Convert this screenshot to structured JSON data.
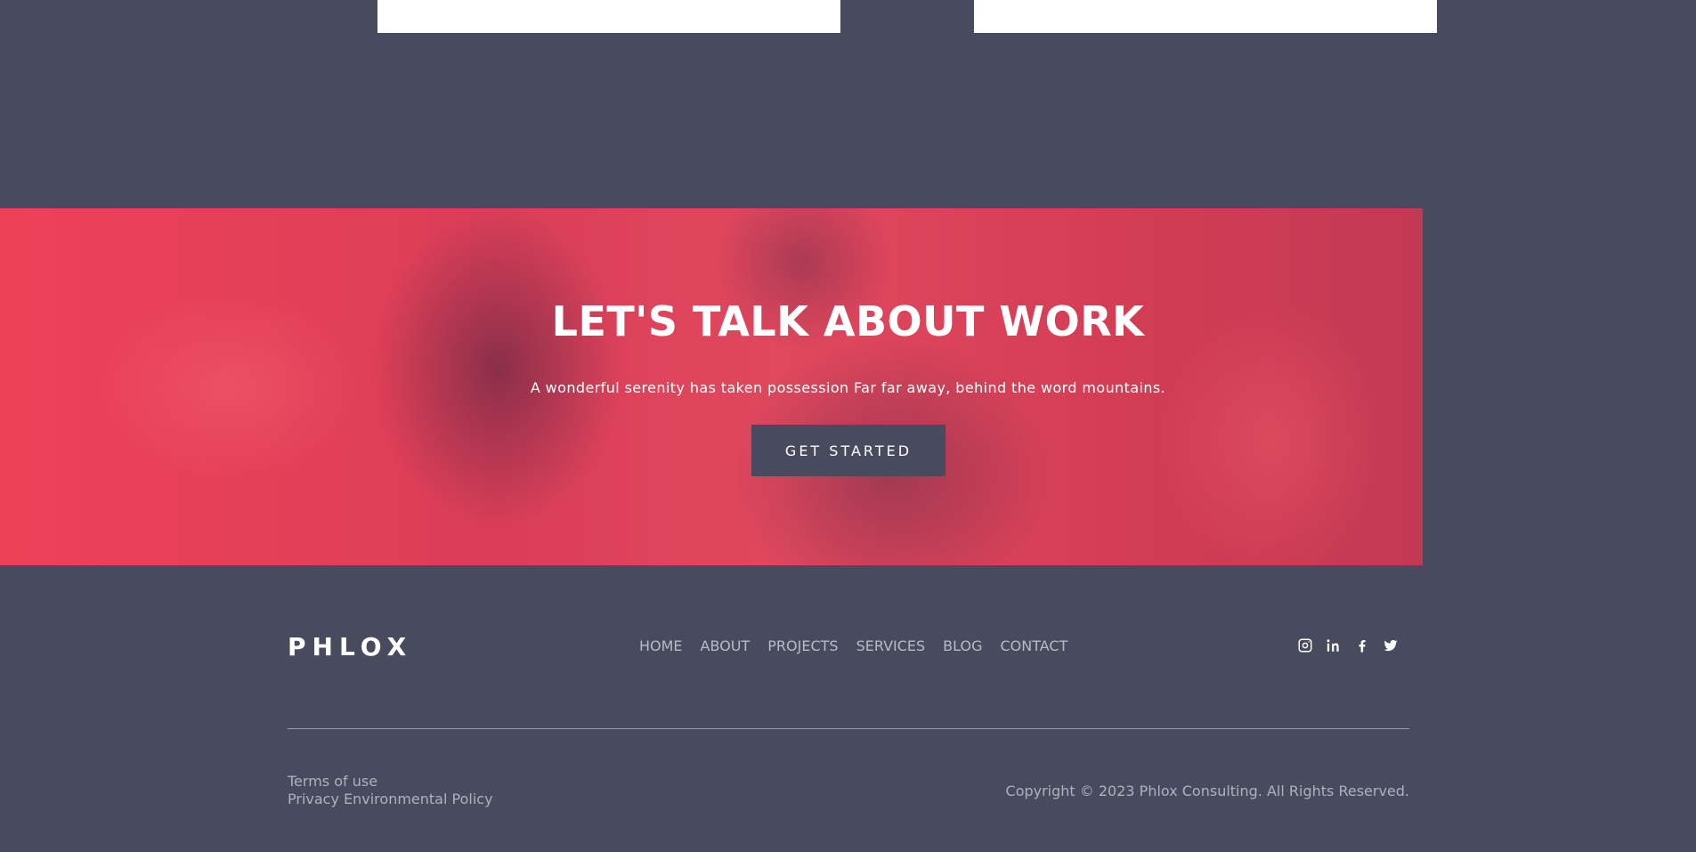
{
  "cta": {
    "title": "LET'S TALK ABOUT WORK",
    "subtitle": "A wonderful serenity has taken possession Far far away, behind the word mountains.",
    "button_label": "GET STARTED"
  },
  "footer": {
    "logo": "PHLOX",
    "nav": [
      "HOME",
      "ABOUT",
      "PROJECTS",
      "SERVICES",
      "BLOG",
      "CONTACT"
    ],
    "social_icons": [
      "instagram-icon",
      "linkedin-icon",
      "facebook-icon",
      "twitter-icon"
    ],
    "legal_links": [
      "Terms of use",
      "Privacy Environmental Policy"
    ],
    "copyright": "Copyright © 2023 Phlox Consulting. All Rights Reserved."
  },
  "colors": {
    "background": "#484a5e",
    "accent": "#f0445b",
    "button": "#484a5e"
  }
}
